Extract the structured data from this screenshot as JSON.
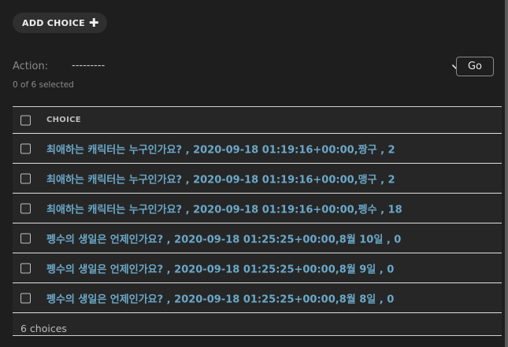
{
  "toolbar": {
    "add_label": "ADD CHOICE",
    "add_icon": "plus-icon"
  },
  "actions": {
    "label": "Action:",
    "selected": "---------",
    "go_label": "Go",
    "counter": "0 of 6 selected"
  },
  "table": {
    "column_header": "CHOICE",
    "rows": [
      {
        "text": "최애하는 캐릭터는 누구인가요? , 2020-09-18 01:19:16+00:00,짱구 , 2"
      },
      {
        "text": "최애하는 캐릭터는 누구인가요? , 2020-09-18 01:19:16+00:00,맹구 , 2"
      },
      {
        "text": "최애하는 캐릭터는 누구인가요? , 2020-09-18 01:19:16+00:00,펭수 , 18"
      },
      {
        "text": "펭수의 생일은 언제인가요? , 2020-09-18 01:25:25+00:00,8월 10일 , 0"
      },
      {
        "text": "펭수의 생일은 언제인가요? , 2020-09-18 01:25:25+00:00,8월 9일 , 0"
      },
      {
        "text": "펭수의 생일은 언제인가요? , 2020-09-18 01:25:25+00:00,8월 8일 , 0"
      }
    ],
    "footer": "6 choices"
  },
  "colors": {
    "background": "#1e1e1e",
    "link": "#6aa8c8",
    "muted": "#8a8a8a"
  }
}
